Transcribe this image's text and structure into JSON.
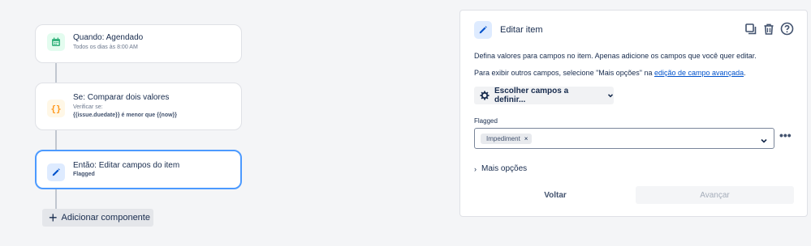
{
  "flow": {
    "trigger": {
      "title": "Quando: Agendado",
      "subtitle": "Todos os dias às 8:00 AM",
      "icon": "calendar-icon",
      "icon_color": "#36b37e"
    },
    "condition": {
      "title": "Se: Comparar dois valores",
      "subtitle": "Verificar se:",
      "detail": "{{issue.duedate}} é menor que {{now}}",
      "icon": "braces-icon",
      "icon_color": "#ff991f"
    },
    "action": {
      "title": "Então: Editar campos do item",
      "subtitle": "Flagged",
      "icon": "pencil-icon",
      "icon_color": "#0052cc"
    },
    "add_component_label": "Adicionar componente"
  },
  "panel": {
    "title": "Editar item",
    "description": "Defina valores para campos no item. Apenas adicione os campos que você quer editar.",
    "hint_prefix": "Para exibir outros campos, selecione \"Mais opções\" na ",
    "hint_link": "edição de campo avançada",
    "hint_suffix": ".",
    "choose_fields_label": "Escolher campos a definir...",
    "field": {
      "label": "Flagged",
      "selected_tag": "Impediment"
    },
    "more_options_label": "Mais opções",
    "back_label": "Voltar",
    "next_label": "Avançar"
  },
  "colors": {
    "accent": "#0052cc",
    "active_border": "#4c9aff"
  }
}
